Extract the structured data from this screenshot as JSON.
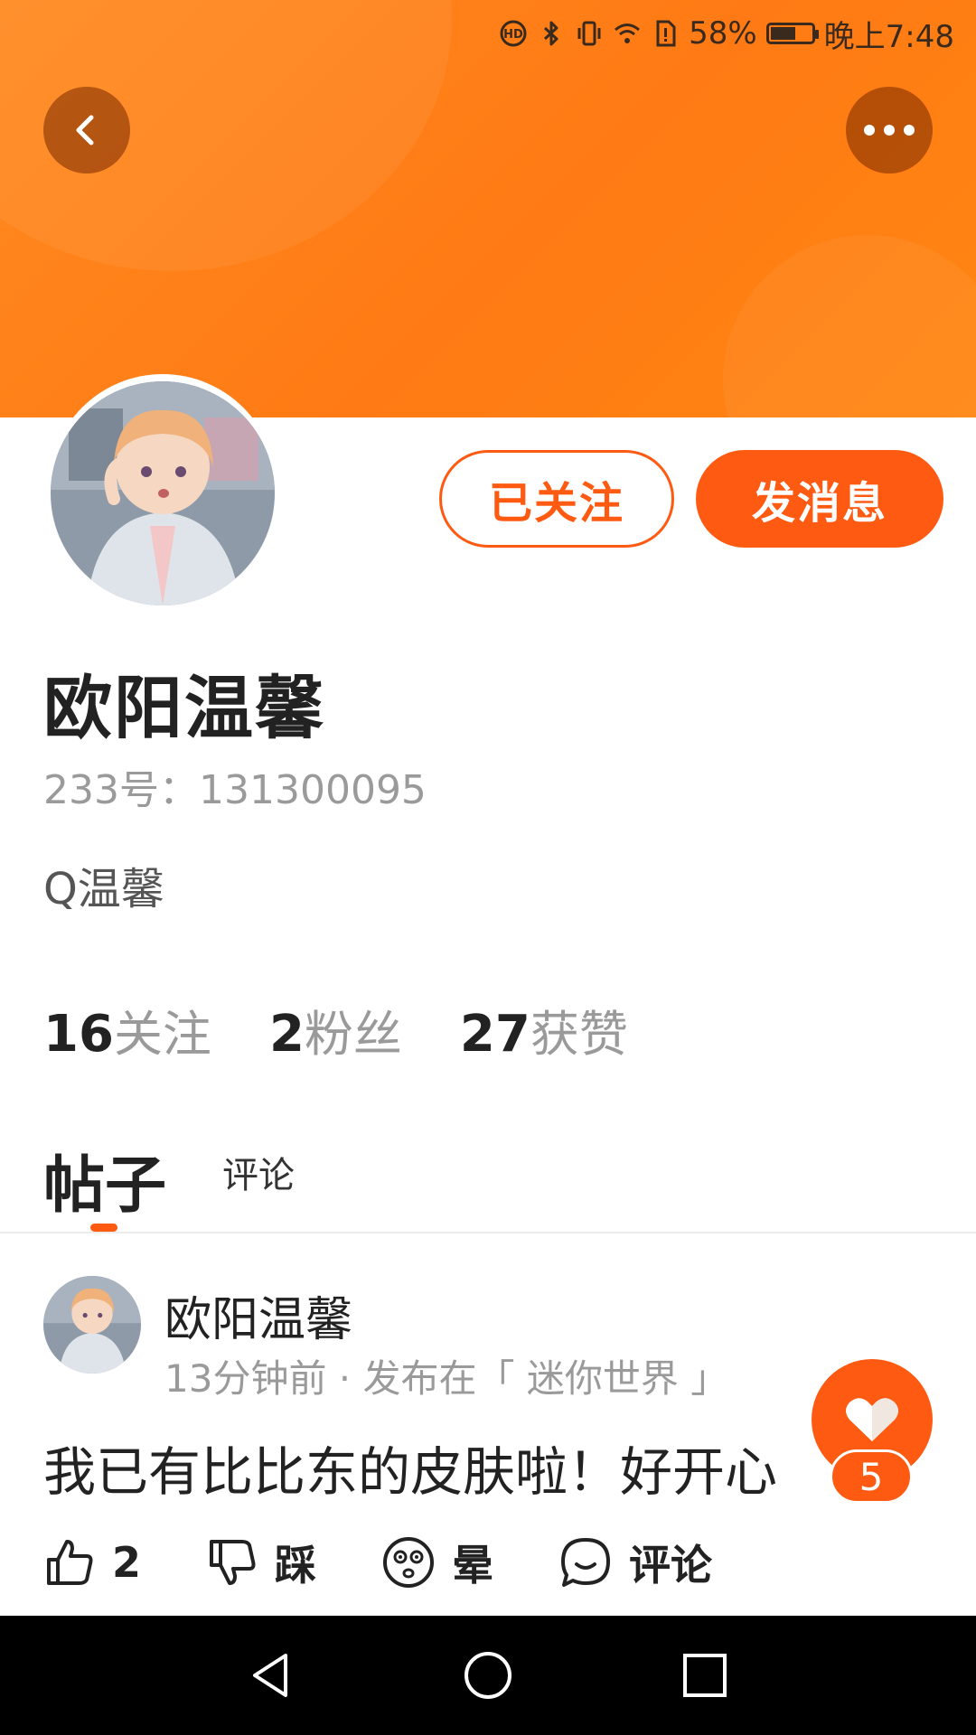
{
  "status_bar": {
    "battery_percent_text": "58%",
    "battery_level": 0.58,
    "time": "晚上7:48",
    "icons": [
      "hd-call-icon",
      "bluetooth-icon",
      "vibrate-icon",
      "wifi-icon",
      "sim-alert-icon",
      "battery-icon"
    ]
  },
  "header": {
    "background_color": "#ff7e1a",
    "back_icon": "chevron-left-icon",
    "more_icon": "more-dots-icon"
  },
  "profile": {
    "name": "欧阳温馨",
    "id_text": "233号：131300095",
    "bio": "Q温馨",
    "follow_button": "已关注",
    "message_button": "发消息",
    "stats": [
      {
        "num": "16",
        "label": "关注"
      },
      {
        "num": "2",
        "label": "粉丝"
      },
      {
        "num": "27",
        "label": "获赞"
      }
    ]
  },
  "tabs": [
    {
      "label": "帖子",
      "active": true
    },
    {
      "label": "评论",
      "active": false
    }
  ],
  "post": {
    "author": "欧阳温馨",
    "meta": "13分钟前 · 发布在「 迷你世界 」",
    "text": "我已有比比东的皮肤啦！好开心",
    "actions": [
      {
        "icon": "thumbs-up-icon",
        "label": "2"
      },
      {
        "icon": "thumbs-down-icon",
        "label": "踩"
      },
      {
        "icon": "dizzy-face-icon",
        "label": "晕"
      },
      {
        "icon": "comment-bubble-icon",
        "label": "评论"
      }
    ]
  },
  "fab": {
    "icon": "heart-icon",
    "badge": "5"
  },
  "nav": {
    "icons": [
      "nav-back-icon",
      "nav-home-icon",
      "nav-recents-icon"
    ]
  },
  "colors": {
    "accent": "#ff5a12",
    "text": "#222222",
    "muted": "#9a9a9a"
  }
}
